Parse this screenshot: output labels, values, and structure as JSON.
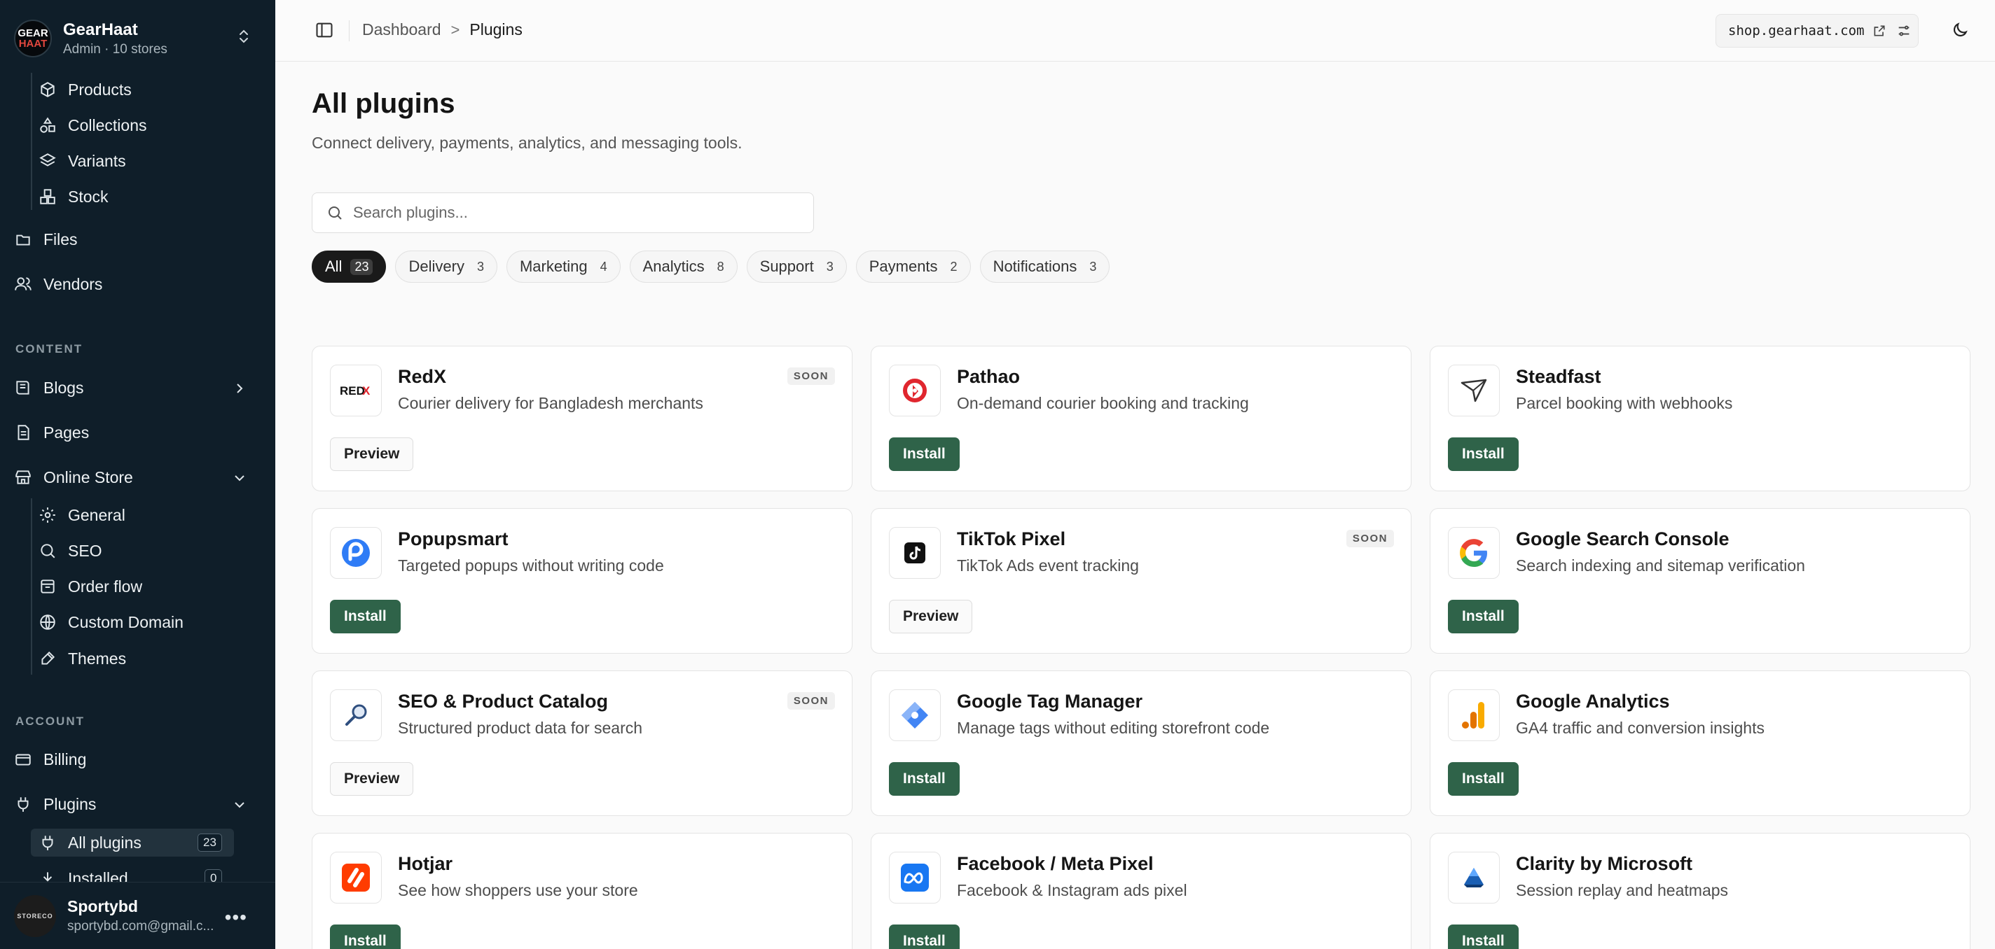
{
  "sidebar": {
    "brand": {
      "logo_line1": "GEAR",
      "logo_line2": "HAAT",
      "name": "GearHaat",
      "subtitle": "Admin · 10 stores"
    },
    "products_sub": [
      "Products",
      "Collections",
      "Variants",
      "Stock"
    ],
    "files": "Files",
    "vendors": "Vendors",
    "content_label": "CONTENT",
    "blogs": "Blogs",
    "pages": "Pages",
    "online_store": "Online Store",
    "online_store_sub": [
      "General",
      "SEO",
      "Order flow",
      "Custom Domain",
      "Themes"
    ],
    "account_label": "ACCOUNT",
    "billing": "Billing",
    "plugins": "Plugins",
    "plugins_sub": [
      {
        "label": "All plugins",
        "count": "23"
      },
      {
        "label": "Installed",
        "count": "0"
      }
    ],
    "user": {
      "logo_text": "STORECO",
      "name": "Sportybd",
      "email": "sportybd.com@gmail.c..."
    }
  },
  "topbar": {
    "breadcrumb": {
      "parent": "Dashboard",
      "separator": ">",
      "current": "Plugins"
    },
    "domain": "shop.gearhaat.com"
  },
  "main": {
    "title": "All plugins",
    "subtitle": "Connect delivery, payments, analytics, and messaging tools.",
    "search_placeholder": "Search plugins...",
    "filters": [
      {
        "label": "All",
        "count": "23",
        "active": true
      },
      {
        "label": "Delivery",
        "count": "3"
      },
      {
        "label": "Marketing",
        "count": "4"
      },
      {
        "label": "Analytics",
        "count": "8"
      },
      {
        "label": "Support",
        "count": "3"
      },
      {
        "label": "Payments",
        "count": "2"
      },
      {
        "label": "Notifications",
        "count": "3"
      }
    ],
    "plugins": [
      {
        "name": "RedX",
        "desc": "Courier delivery for Bangladesh merchants",
        "badge": "SOON",
        "action": "Preview",
        "icon": "redx-logo"
      },
      {
        "name": "Pathao",
        "desc": "On-demand courier booking and tracking",
        "badge": "",
        "action": "Install",
        "icon": "pathao-logo"
      },
      {
        "name": "Steadfast",
        "desc": "Parcel booking with webhooks",
        "badge": "",
        "action": "Install",
        "icon": "steadfast-logo"
      },
      {
        "name": "Popupsmart",
        "desc": "Targeted popups without writing code",
        "badge": "",
        "action": "Install",
        "icon": "popupsmart-logo"
      },
      {
        "name": "TikTok Pixel",
        "desc": "TikTok Ads event tracking",
        "badge": "SOON",
        "action": "Preview",
        "icon": "tiktok-logo"
      },
      {
        "name": "Google Search Console",
        "desc": "Search indexing and sitemap verification",
        "badge": "",
        "action": "Install",
        "icon": "google-logo"
      },
      {
        "name": "SEO & Product Catalog",
        "desc": "Structured product data for search",
        "badge": "SOON",
        "action": "Preview",
        "icon": "seo-magnifier-logo"
      },
      {
        "name": "Google Tag Manager",
        "desc": "Manage tags without editing storefront code",
        "badge": "",
        "action": "Install",
        "icon": "gtm-logo"
      },
      {
        "name": "Google Analytics",
        "desc": "GA4 traffic and conversion insights",
        "badge": "",
        "action": "Install",
        "icon": "google-analytics-logo"
      },
      {
        "name": "Hotjar",
        "desc": "See how shoppers use your store",
        "badge": "",
        "action": "Install",
        "icon": "hotjar-logo"
      },
      {
        "name": "Facebook / Meta Pixel",
        "desc": "Facebook & Instagram ads pixel",
        "badge": "",
        "action": "Install",
        "icon": "meta-logo"
      },
      {
        "name": "Clarity by Microsoft",
        "desc": "Session replay and heatmaps",
        "badge": "",
        "action": "Install",
        "icon": "clarity-logo"
      }
    ]
  },
  "colors": {
    "sidebar_bg": "#0f1e29",
    "install_btn": "#2f6349",
    "active_chip": "#1a1a1a"
  }
}
